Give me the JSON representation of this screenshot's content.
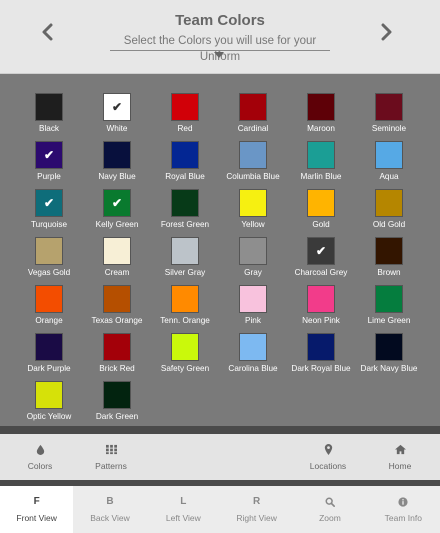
{
  "header": {
    "title": "Team Colors",
    "subtitle": "Select the Colors you will use for your Uniform"
  },
  "colors": [
    {
      "name": "Black",
      "hex": "#1e1e1e",
      "selected": false
    },
    {
      "name": "White",
      "hex": "#ffffff",
      "selected": true
    },
    {
      "name": "Red",
      "hex": "#d10008",
      "selected": false
    },
    {
      "name": "Cardinal",
      "hex": "#a30009",
      "selected": false
    },
    {
      "name": "Maroon",
      "hex": "#5e0007",
      "selected": false
    },
    {
      "name": "Seminole",
      "hex": "#6b0c1d",
      "selected": false
    },
    {
      "name": "Purple",
      "hex": "#2c0a6f",
      "selected": true
    },
    {
      "name": "Navy Blue",
      "hex": "#08103d",
      "selected": false
    },
    {
      "name": "Royal Blue",
      "hex": "#032693",
      "selected": false
    },
    {
      "name": "Columbia Blue",
      "hex": "#6a96c6",
      "selected": false
    },
    {
      "name": "Marlin Blue",
      "hex": "#1b9e95",
      "selected": false
    },
    {
      "name": "Aqua",
      "hex": "#56a9e5",
      "selected": false
    },
    {
      "name": "Turquoise",
      "hex": "#0e6d7a",
      "selected": true
    },
    {
      "name": "Kelly Green",
      "hex": "#097a2e",
      "selected": true
    },
    {
      "name": "Forest Green",
      "hex": "#073a18",
      "selected": false
    },
    {
      "name": "Yellow",
      "hex": "#f6f011",
      "selected": false
    },
    {
      "name": "Gold",
      "hex": "#ffb400",
      "selected": false
    },
    {
      "name": "Old Gold",
      "hex": "#b58600",
      "selected": false
    },
    {
      "name": "Vegas Gold",
      "hex": "#b6a26d",
      "selected": false
    },
    {
      "name": "Cream",
      "hex": "#f7efd6",
      "selected": false
    },
    {
      "name": "Silver Gray",
      "hex": "#bcc3c9",
      "selected": false
    },
    {
      "name": "Gray",
      "hex": "#8e8e8e",
      "selected": false
    },
    {
      "name": "Charcoal Grey",
      "hex": "#3a3a3a",
      "selected": true
    },
    {
      "name": "Brown",
      "hex": "#331500",
      "selected": false
    },
    {
      "name": "Orange",
      "hex": "#f34d00",
      "selected": false
    },
    {
      "name": "Texas Orange",
      "hex": "#b54f00",
      "selected": false
    },
    {
      "name": "Tenn. Orange",
      "hex": "#ff8a00",
      "selected": false
    },
    {
      "name": "Pink",
      "hex": "#f8c2dd",
      "selected": false
    },
    {
      "name": "Neon Pink",
      "hex": "#f23c8a",
      "selected": false
    },
    {
      "name": "Lime Green",
      "hex": "#057d3e",
      "selected": false
    },
    {
      "name": "Dark Purple",
      "hex": "#1a0b45",
      "selected": false
    },
    {
      "name": "Brick Red",
      "hex": "#a30009",
      "selected": false
    },
    {
      "name": "Safety Green",
      "hex": "#caf90b",
      "selected": false
    },
    {
      "name": "Carolina Blue",
      "hex": "#7db9f1",
      "selected": false
    },
    {
      "name": "Dark Royal Blue",
      "hex": "#061a6b",
      "selected": false
    },
    {
      "name": "Dark Navy Blue",
      "hex": "#020a1f",
      "selected": false
    },
    {
      "name": "Optic Yellow",
      "hex": "#d6e109",
      "selected": false
    },
    {
      "name": "Dark Green",
      "hex": "#02230f",
      "selected": false
    }
  ],
  "toolbar": [
    {
      "label": "Colors",
      "icon": "drop-icon"
    },
    {
      "label": "Patterns",
      "icon": "grid-icon"
    },
    {
      "label": "Locations",
      "icon": "map-marker-icon"
    },
    {
      "label": "Home",
      "icon": "home-icon"
    }
  ],
  "views": [
    {
      "key": "F",
      "label": "Front View",
      "active": true
    },
    {
      "key": "B",
      "label": "Back View",
      "active": false
    },
    {
      "key": "L",
      "label": "Left View",
      "active": false
    },
    {
      "key": "R",
      "label": "Right View",
      "active": false
    },
    {
      "key": "",
      "label": "Zoom",
      "icon": "search-icon",
      "active": false
    },
    {
      "key": "",
      "label": "Team Info",
      "icon": "info-icon",
      "active": false
    }
  ]
}
